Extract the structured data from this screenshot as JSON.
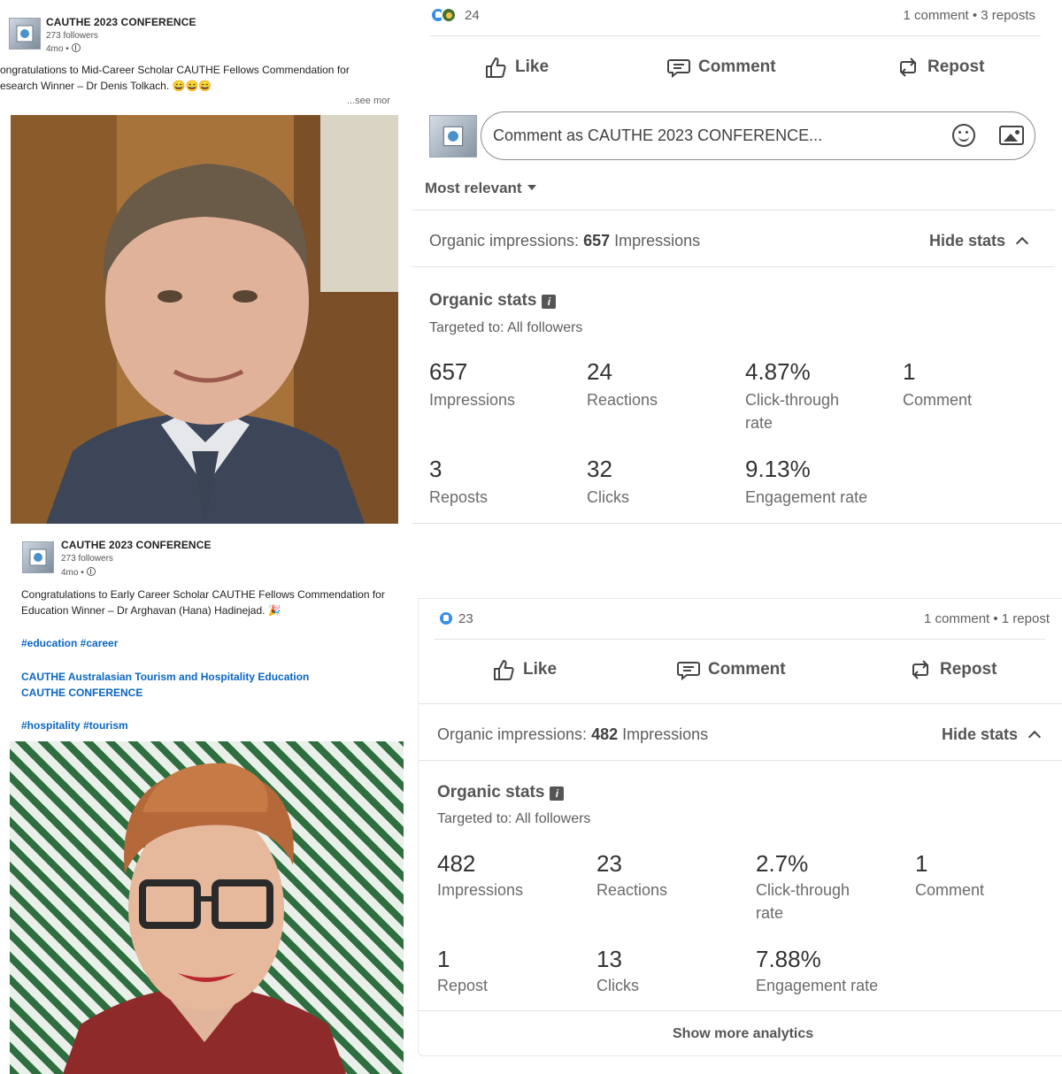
{
  "post1": {
    "author": "CAUTHE 2023 CONFERENCE",
    "followers": "273 followers",
    "age": "4mo •",
    "text_line1": "ongratulations to Mid-Career Scholar CAUTHE Fellows Commendation for",
    "text_line2": "esearch Winner – Dr Denis Tolkach. 😄😄😄",
    "see_more": "...see mor"
  },
  "post2": {
    "author": "CAUTHE 2023 CONFERENCE",
    "followers": "273 followers",
    "age": "4mo •",
    "text_line1": "Congratulations to Early Career Scholar CAUTHE Fellows Commendation for",
    "text_line2": "Education Winner – Dr Arghavan (Hana) Hadinejad. 🎉",
    "hashtags1": "#education #career",
    "mention1": "CAUTHE Australasian Tourism and Hospitality Education",
    "mention2": "CAUTHE CONFERENCE",
    "hashtags2": "#hospitality #tourism"
  },
  "panel1": {
    "reactions_count": "24",
    "counts": "1 comment • 3 reposts",
    "actions": {
      "like": "Like",
      "comment": "Comment",
      "repost": "Repost"
    },
    "comment_placeholder": "Comment as CAUTHE 2023 CONFERENCE...",
    "sort": "Most relevant",
    "impressions_prefix": "Organic impressions: ",
    "impressions_value": "657",
    "impressions_suffix": " Impressions",
    "hide_stats": "Hide stats",
    "stats_title": "Organic stats",
    "targeted": "Targeted to: All followers",
    "stats": [
      {
        "value": "657",
        "label": "Impressions"
      },
      {
        "value": "24",
        "label": "Reactions"
      },
      {
        "value": "4.87%",
        "label": "Click-through rate"
      },
      {
        "value": "1",
        "label": "Comment"
      },
      {
        "value": "3",
        "label": "Reposts"
      },
      {
        "value": "32",
        "label": "Clicks"
      },
      {
        "value": "9.13%",
        "label": "Engagement rate"
      }
    ]
  },
  "panel2": {
    "reactions_count": "23",
    "counts": "1 comment • 1 repost",
    "actions": {
      "like": "Like",
      "comment": "Comment",
      "repost": "Repost"
    },
    "impressions_prefix": "Organic impressions: ",
    "impressions_value": "482",
    "impressions_suffix": " Impressions",
    "hide_stats": "Hide stats",
    "stats_title": "Organic stats",
    "targeted": "Targeted to: All followers",
    "stats": [
      {
        "value": "482",
        "label": "Impressions"
      },
      {
        "value": "23",
        "label": "Reactions"
      },
      {
        "value": "2.7%",
        "label": "Click-through rate"
      },
      {
        "value": "1",
        "label": "Comment"
      },
      {
        "value": "1",
        "label": "Repost"
      },
      {
        "value": "13",
        "label": "Clicks"
      },
      {
        "value": "7.88%",
        "label": "Engagement rate"
      }
    ],
    "show_more": "Show more analytics"
  },
  "colors": {
    "link": "#0a66c2",
    "like_blue": "#378fe9",
    "text_gray": "#5e5e5e"
  }
}
